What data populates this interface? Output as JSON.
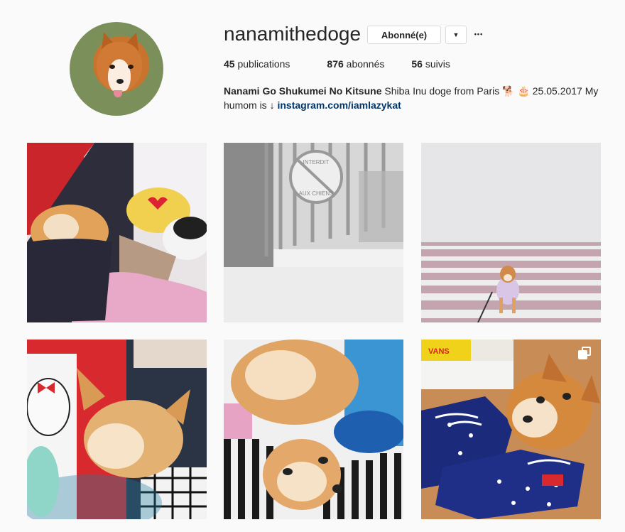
{
  "profile": {
    "username": "nanamithedoge",
    "follow_label": "Abonné(e)",
    "dropdown_glyph": "▼",
    "more_glyph": "•••",
    "avatar_icon": "profile-avatar"
  },
  "stats": {
    "posts_count": "45",
    "posts_label": "publications",
    "followers_count": "876",
    "followers_label": "abonnés",
    "following_count": "56",
    "following_label": "suivis"
  },
  "bio": {
    "name": "Nanami Go Shukumei No Kitsune",
    "text": " Shiba Inu doge from Paris 🐕 🎂 25.05.2017 My humom is ↓ ",
    "link": "instagram.com/iamlazykat"
  },
  "posts": [
    {
      "icon": "post-image",
      "description_colors": [
        "#c22",
        "#2b2b3a",
        "#e8a"
      ],
      "multi": false
    },
    {
      "icon": "post-image",
      "description_colors": [
        "#ddd",
        "#999"
      ],
      "multi": false
    },
    {
      "icon": "post-image",
      "description_colors": [
        "#e4e4e6",
        "#c9a4b0"
      ],
      "multi": false
    },
    {
      "icon": "post-image",
      "description_colors": [
        "#d22",
        "#e8b074"
      ],
      "multi": false
    },
    {
      "icon": "post-image",
      "description_colors": [
        "#3aa0d8",
        "#e8a868"
      ],
      "multi": false
    },
    {
      "icon": "post-image",
      "description_colors": [
        "#1b2a7a",
        "#d07a3a"
      ],
      "multi": true,
      "multi_icon": "carousel-icon"
    }
  ]
}
